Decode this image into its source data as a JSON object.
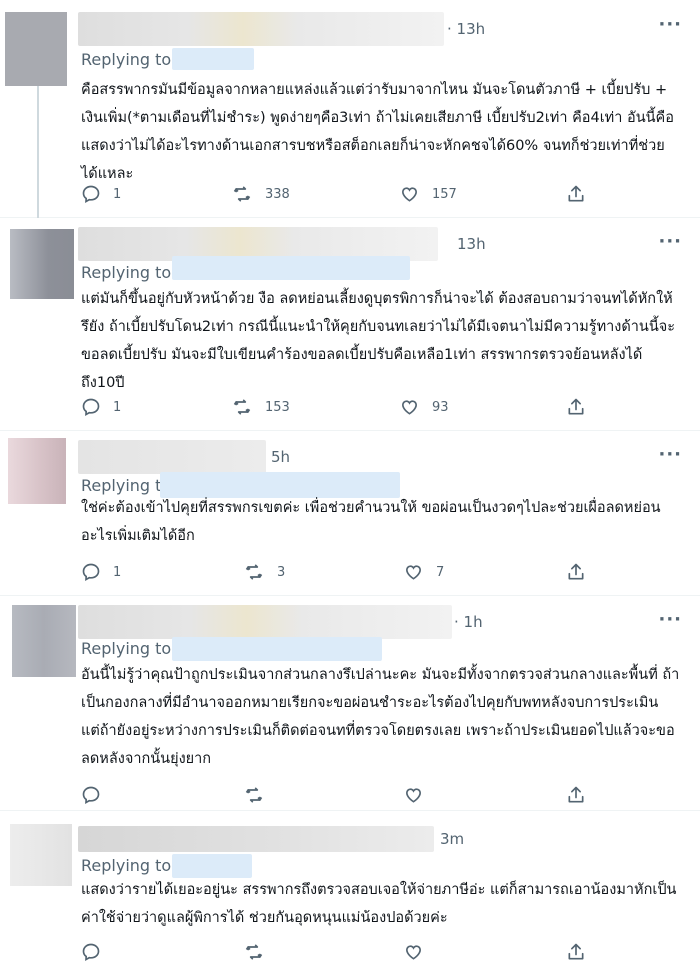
{
  "replies": [
    {
      "time": "· 13h",
      "replying_prefix": "Replying to",
      "text": "คือสรรพากรมันมีข้อมูลจากหลายแหล่งแล้วแต่ว่ารับมาจากไหน มันจะโดนตัวภาษี + เบี้ยปรับ + เงินเพิ่ม(*ตามเดือนที่ไม่ชำระ) พูดง่ายๆคือ3เท่า ถ้าไม่เคยเสียภาษี เบี้ยปรับ2เท่า คือ4เท่า อันนี้คือแสดงว่าไม่ได้อะไรทางด้านเอกสารบชหรือสต็อกเลยก็น่าจะหักคชจได้60% จนทก็ช่วยเท่าที่ช่วยได้แหละ",
      "replies_count": "1",
      "retweets_count": "338",
      "likes_count": "157"
    },
    {
      "time": "13h",
      "replying_prefix": "Replying to",
      "text": "แต่มันก็ขึ้นอยู่กับหัวหน้าด้วย งือ ลดหย่อนเลี้ยงดูบุตรพิการก็น่าจะได้ ต้องสอบถามว่าจนทได้หักให้รึยัง ถ้าเบี้ยปรับโดน2เท่า กรณีนี้แนะนำให้คุยกับจนทเลยว่าไม่ได้มีเจตนาไม่มีความรู้ทางด้านนี้จะขอลดเบี้ยปรับ มันจะมีใบเขียนคำร้องขอลดเบี้ยปรับคือเหลือ1เท่า สรรพากรตรวจย้อนหลังได้ถึง10ปี",
      "replies_count": "1",
      "retweets_count": "153",
      "likes_count": "93"
    },
    {
      "time": "5h",
      "replying_prefix": "Replying to",
      "text": "ใช่ค่ะต้องเข้าไปคุยที่สรรพกรเขตค่ะ เพื่อช่วยคำนวนให้ ขอผ่อนเป็นงวดๆไปละช่วยเผื่อลดหย่อนอะไรเพิ่มเติมได้อีก",
      "replies_count": "1",
      "retweets_count": "3",
      "likes_count": "7"
    },
    {
      "time": "· 1h",
      "replying_prefix": "Replying to",
      "text": "อันนี้ไม่รู้ว่าคุณป้าถูกประเมินจากส่วนกลางรึเปล่านะคะ มันจะมีทั้งจากตรวจส่วนกลางและพื้นที่ ถ้าเป็นกองกลางที่มีอำนาจออกหมายเรียกจะขอผ่อนชำระอะไรต้องไปคุยกับพทหลังจบการประเมิน แต่ถ้ายังอยู่ระหว่างการประเมินก็ติดต่อจนทที่ตรวจโดยตรงเลย เพราะถ้าประเมินยอดไปแล้วจะขอลดหลังจากนั้นยุ่งยาก",
      "replies_count": "",
      "retweets_count": "",
      "likes_count": ""
    },
    {
      "time": "3m",
      "replying_prefix": "Replying to",
      "text": "แสดงว่ารายได้เยอะอยู่นะ สรรพากรถึงตรวจสอบเจอให้จ่ายภาษีอ่ะ แต่ก็สามารถเอาน้องมาหักเป็นค่าใช้จ่ายว่าดูแลผู้พิการได้ ช่วยกันอุดหนุนแม่น้องปอด้วยค่ะ",
      "replies_count": "",
      "retweets_count": "",
      "likes_count": ""
    }
  ],
  "icons": {
    "reply": "reply-icon",
    "retweet": "retweet-icon",
    "like": "heart-icon",
    "share": "share-icon",
    "more": "more-icon"
  },
  "colors": {
    "text": "#0f1419",
    "muted": "#536471",
    "thread_line": "#cfd9de",
    "separator": "#eff3f4"
  }
}
